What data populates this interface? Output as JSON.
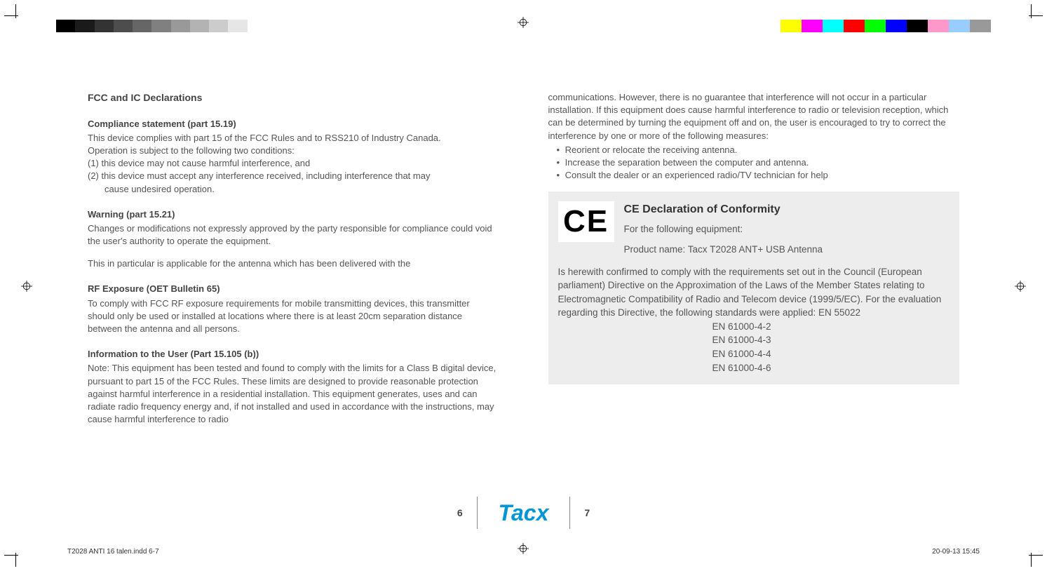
{
  "left_column": {
    "main_heading": "FCC and IC Declarations",
    "section1_heading": "Compliance statement (part 15.19)",
    "section1_p1": "This device complies with part 15 of the FCC Rules and to RSS210 of Industry Canada.",
    "section1_p2": "Operation is subject to the following two conditions:",
    "section1_li1": "(1) this device may not cause harmful interference, and",
    "section1_li2a": "(2) this device must accept any interference received, including interference that may",
    "section1_li2b": "cause undesired operation.",
    "section2_heading": "Warning (part 15.21)",
    "section2_p1": "Changes or modifications not expressly approved by the party responsible for compliance could void the user's authority to operate the equipment.",
    "section2_p2": "This in particular is applicable for the antenna which has been delivered with the",
    "section3_heading": "RF Exposure (OET Bulletin 65)",
    "section3_p1": "To comply with FCC RF exposure requirements for mobile transmitting devices, this transmitter should only be used or installed at locations where there is at least 20cm separation distance between the antenna and all persons.",
    "section4_heading": "Information to the User (Part 15.105 (b))",
    "section4_p1": "Note: This equipment has been tested and found to comply with the limits for a Class B digital device, pursuant to part 15 of the FCC Rules. These limits are designed to provide reasonable protection against harmful interference in a residential installation. This equipment generates, uses and can radiate radio frequency energy and, if not installed and used in accordance with the instructions, may cause harmful interference to radio"
  },
  "right_column": {
    "continuation": "communications. However, there is no guarantee that interference will not occur in a  particular installation. If this equipment does cause harmful interference to radio or television reception, which can be determined by turning the equipment off and on, the user is encouraged to try to correct the interference by one or more of the following measures:",
    "bullet1": "Reorient or relocate the receiving antenna.",
    "bullet2": "Increase the separation between the computer and antenna.",
    "bullet3": "Consult the dealer or an experienced radio/TV technician for help",
    "ce_title": "CE Declaration of Conformity",
    "ce_line1": "For the following equipment:",
    "ce_line2": "Product name: Tacx T2028 ANT+ USB Antenna",
    "ce_body": "Is herewith confirmed to comply with the requirements set out in the Council (European parliament) Directive on the Approximation of the Laws of the Member States relating to Electromagnetic Compatibility of Radio and Telecom device (1999/5/EC). For the evaluation regarding this Directive, the following standards were applied: EN 55022",
    "std1": "EN 61000-4-2",
    "std2": "EN 61000-4-3",
    "std3": "EN 61000-4-4",
    "std4": "EN 61000-4-6",
    "ce_mark": "CE"
  },
  "footer": {
    "page_left": "6",
    "page_right": "7",
    "logo_text": "Tacx",
    "file_info": "T2028 ANTI 16 talen.indd   6-7",
    "timestamp": "20-09-13   15:45"
  },
  "colors": {
    "grayscale": [
      "#000",
      "#1a1a1a",
      "#333",
      "#4d4d4d",
      "#666",
      "#808080",
      "#999",
      "#b3b3b3",
      "#ccc",
      "#e6e6e6",
      "#fff"
    ],
    "process": [
      "#ffff00",
      "#ff00ff",
      "#00ffff",
      "#ff0000",
      "#00ff00",
      "#0000ff",
      "#000000",
      "#ff99cc",
      "#99ccff",
      "#999999"
    ]
  }
}
